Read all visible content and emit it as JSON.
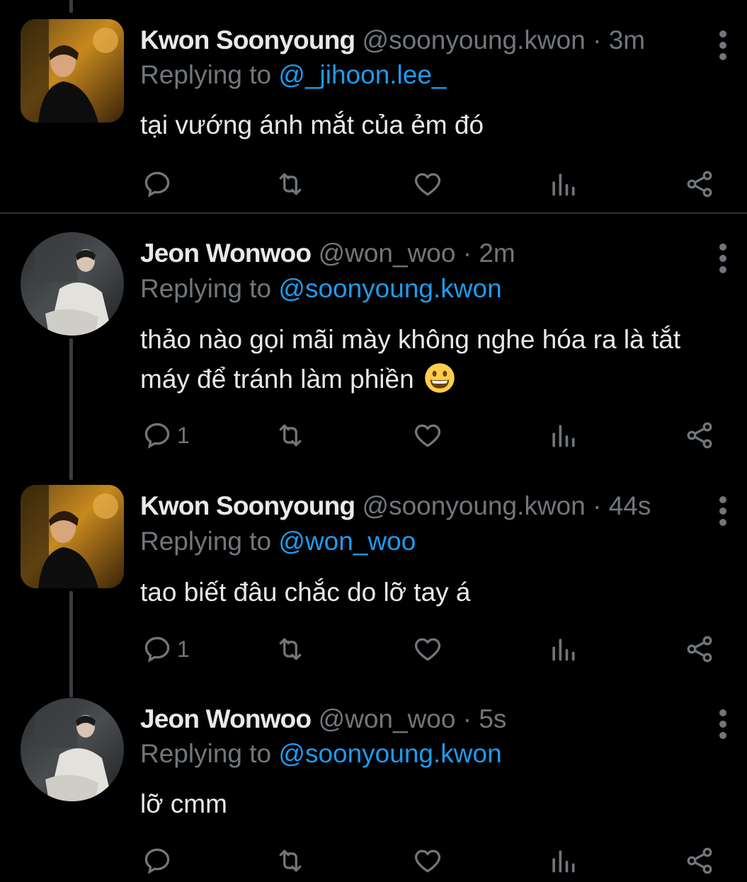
{
  "tweets": [
    {
      "name": "Kwon Soonyoung",
      "handle": "@soonyoung.kwon",
      "time": "3m",
      "replying_label": "Replying to",
      "replying_to": "@_jihoon.lee_",
      "text": "tại vướng ánh mắt của ẻm đó",
      "reply_count": "",
      "avatar": "avatar-soonyoung"
    },
    {
      "name": "Jeon Wonwoo",
      "handle": "@won_woo",
      "time": "2m",
      "replying_label": "Replying to",
      "replying_to": "@soonyoung.kwon",
      "text_line1": "thảo nào gọi mãi mày không nghe hóa ra là tắt",
      "text_line2": "máy để tránh làm phiền",
      "emoji": "grinning-face",
      "reply_count": "1",
      "avatar": "avatar-wonwoo"
    },
    {
      "name": "Kwon Soonyoung",
      "handle": "@soonyoung.kwon",
      "time": "44s",
      "replying_label": "Replying to",
      "replying_to": "@won_woo",
      "text": "tao biết đâu chắc do lỡ tay á",
      "reply_count": "1",
      "avatar": "avatar-soonyoung"
    },
    {
      "name": "Jeon Wonwoo",
      "handle": "@won_woo",
      "time": "5s",
      "replying_label": "Replying to",
      "replying_to": "@soonyoung.kwon",
      "text": "lỡ cmm",
      "reply_count": "",
      "avatar": "avatar-wonwoo"
    }
  ],
  "dot": "·",
  "icons": [
    "reply-icon",
    "retweet-icon",
    "like-icon",
    "analytics-icon",
    "share-icon",
    "more-icon"
  ],
  "colors": {
    "background": "#000000",
    "text": "#e7e9ea",
    "muted": "#71767b",
    "link": "#1d9bf0"
  }
}
